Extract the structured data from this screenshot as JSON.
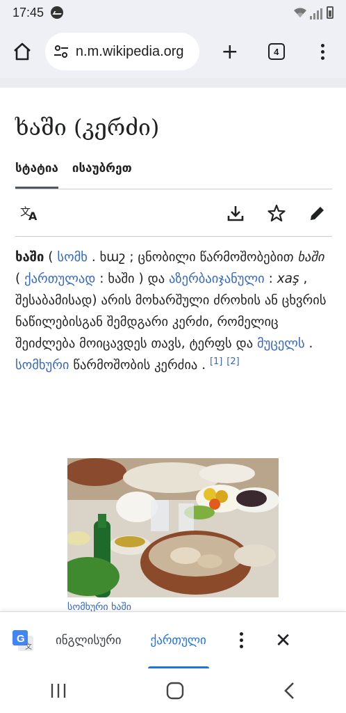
{
  "status_bar": {
    "time": "17:45"
  },
  "toolbar": {
    "url": "n.m.wikipedia.org",
    "tab_count": "4"
  },
  "page": {
    "title": "ხაში (კერძი)",
    "tabs": [
      "სტატია",
      "ისაუბრეთ"
    ]
  },
  "article": {
    "p": {
      "w1": "ხაში",
      "t1": " ( ",
      "l1": "სომხ",
      "t2": " . ხաշ ; ცნობილი წარმოშობებით ",
      "i1": "ხაში",
      "t3": " ( ",
      "l2": "ქართულად",
      "t4": " : ხაში ) და ",
      "l3": "აზერბაიჯანული",
      "t5": " : ",
      "i2": "xaş",
      "t6": " , შესაბამისად) არის მოხარშული ძროხის ან ცხვრის ნაწილებისგან შემდგარი კერძი, რომელიც შეიძლება მოიცავდეს თავს, ტერფს და ",
      "l4": "მუცელს",
      "t7": " . ",
      "l5": "სომხური",
      "t8": " წარმოშობის კერძია . ",
      "r1": "[1]",
      "r2": "[2]"
    },
    "caption": "სომხური ხაში"
  },
  "translate_bar": {
    "source_lang": "ინგლისური",
    "target_lang": "ქართული"
  },
  "colors": {
    "link": "#3366cc",
    "accent": "#1a73e8",
    "chrome_bg": "#eef0f5"
  }
}
